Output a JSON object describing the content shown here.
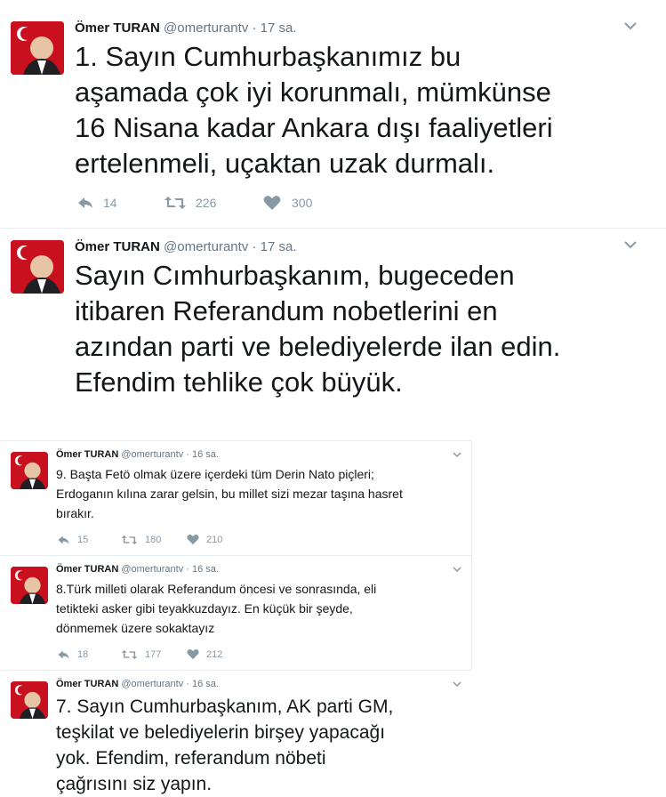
{
  "tweets_top": [
    {
      "name": "Ömer TURAN",
      "handle": "@omerturantv",
      "time": "17 sa.",
      "text": "1. Sayın Cumhurbaşkanımız bu\naşamada çok iyi korunmalı, mümkünse\n16 Nisana kadar Ankara dışı faaliyetleri\nertelenmeli, uçaktan uzak durmalı.",
      "replies": "14",
      "retweets": "226",
      "likes": "300"
    },
    {
      "name": "Ömer TURAN",
      "handle": "@omerturantv",
      "time": "17 sa.",
      "text": "Sayın Cımhurbaşkanım, bugeceden\nitibaren Referandum nobetlerini en\nazından parti ve belediyelerde ilan edin.\nEfendim tehlike çok büyük."
    }
  ],
  "tweets_small": [
    {
      "name": "Ömer TURAN",
      "handle": "@omerturantv",
      "time": "16 sa.",
      "text": "9. Başta Fetö olmak üzere içerdeki tüm Derin Nato piçleri;\nErdoganın kılına zarar gelsin, bu millet sizi mezar taşına hasret\nbırakır.",
      "replies": "15",
      "retweets": "180",
      "likes": "210"
    },
    {
      "name": "Ömer TURAN",
      "handle": "@omerturantv",
      "time": "16 sa.",
      "text": "8.Türk milleti olarak Referandum öncesi ve sonrasında, eli\ntetikteki asker gibi teyakkuzdayız. En küçük bir şeyde,\ndönmemek üzere sokaktayız",
      "replies": "18",
      "retweets": "177",
      "likes": "212"
    },
    {
      "name": "Ömer TURAN",
      "handle": "@omerturantv",
      "time": "16 sa.",
      "text": "7. Sayın Cumhurbaşkanım, AK parti GM,\nteşkilat ve belediyelerin birşey yapacağı\nyok. Efendim, referandum nöbeti\nçağrısını siz yapın."
    }
  ],
  "colors": {
    "text": "#14171a",
    "muted": "#657786",
    "icon": "#8899a6",
    "divider": "#e6ecf0",
    "avatar_bg": "#c8101e"
  },
  "icons": [
    "reply-icon",
    "retweet-icon",
    "like-icon",
    "caret-down-icon",
    "avatar"
  ]
}
